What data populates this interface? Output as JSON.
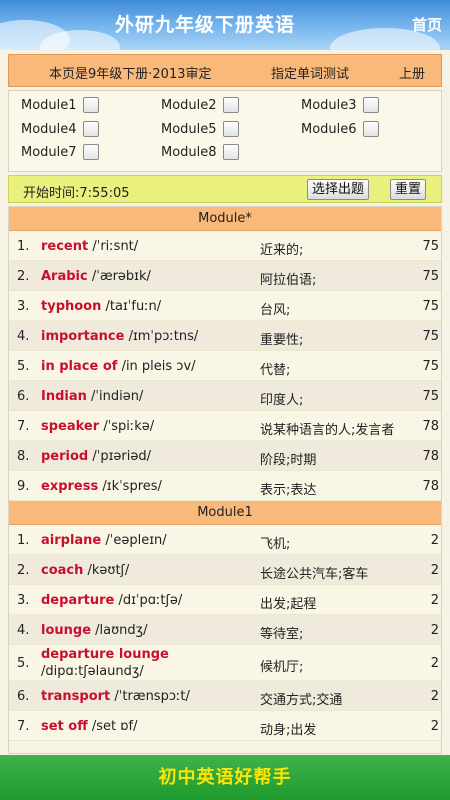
{
  "header": {
    "title": "外研九年级下册英语",
    "home_label": "首页"
  },
  "info": {
    "text": "本页是9年级下册·2013审定",
    "test_link": "指定单词测试",
    "volume_link": "上册"
  },
  "modules": [
    "Module1",
    "Module2",
    "Module3",
    "Module4",
    "Module5",
    "Module6",
    "Module7",
    "Module8"
  ],
  "timebar": {
    "start_time": "开始时间:7:55:05",
    "choose_button": "选择出题",
    "reset_button": "重置"
  },
  "sections": [
    {
      "title": "Module*",
      "words": [
        {
          "num": "1.",
          "word": "recent",
          "phonetic": "/ˈriːsnt/",
          "meaning": "近来的;",
          "count": "75"
        },
        {
          "num": "2.",
          "word": "Arabic",
          "phonetic": "/ˈærəbɪk/",
          "meaning": "阿拉伯语;",
          "count": "75"
        },
        {
          "num": "3.",
          "word": "typhoon",
          "phonetic": "/taɪˈfuːn/",
          "meaning": "台风;",
          "count": "75"
        },
        {
          "num": "4.",
          "word": "importance",
          "phonetic": "/ɪmˈpɔːtns/",
          "meaning": "重要性;",
          "count": "75"
        },
        {
          "num": "5.",
          "word": "in place of",
          "phonetic": "/in pleis ɔv/",
          "meaning": "代替;",
          "count": "75"
        },
        {
          "num": "6.",
          "word": "Indian",
          "phonetic": "/ˈindiən/",
          "meaning": "印度人;",
          "count": "75"
        },
        {
          "num": "7.",
          "word": "speaker",
          "phonetic": "/ˈspiːkə/",
          "meaning": "说某种语言的人;发言者",
          "count": "78"
        },
        {
          "num": "8.",
          "word": "period",
          "phonetic": "/ˈpɪəriəd/",
          "meaning": "阶段;时期",
          "count": "78"
        },
        {
          "num": "9.",
          "word": "express",
          "phonetic": "/ɪkˈspres/",
          "meaning": "表示;表达",
          "count": "78"
        }
      ]
    },
    {
      "title": "Module1",
      "words": [
        {
          "num": "1.",
          "word": "airplane",
          "phonetic": "/ˈeəpleɪn/",
          "meaning": "飞机;",
          "count": "2"
        },
        {
          "num": "2.",
          "word": "coach",
          "phonetic": "/kəʊtʃ/",
          "meaning": "长途公共汽车;客车",
          "count": "2"
        },
        {
          "num": "3.",
          "word": "departure",
          "phonetic": "/dɪˈpɑːtʃə/",
          "meaning": "出发;起程",
          "count": "2"
        },
        {
          "num": "4.",
          "word": "lounge",
          "phonetic": "/laʊndʒ/",
          "meaning": "等待室;",
          "count": "2"
        },
        {
          "num": "5.",
          "word": "departure lounge",
          "phonetic": "/dipɑ:tʃəlaundʒ/",
          "meaning": "候机厅;",
          "count": "2"
        },
        {
          "num": "6.",
          "word": "transport",
          "phonetic": "/ˈtrænspɔːt/",
          "meaning": "交通方式;交通",
          "count": "2"
        },
        {
          "num": "7.",
          "word": "set off",
          "phonetic": "/set ɒf/",
          "meaning": "动身;出发",
          "count": "2"
        }
      ]
    }
  ],
  "footer": {
    "text": "初中英语好帮手"
  }
}
